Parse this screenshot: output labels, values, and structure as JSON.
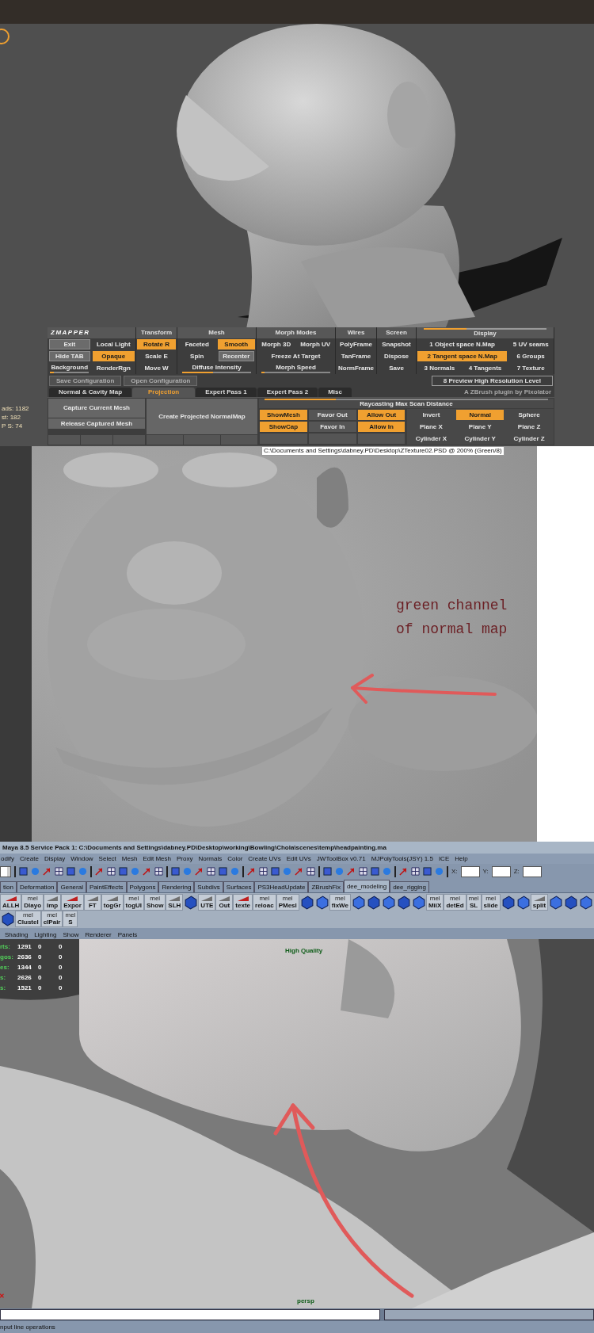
{
  "zbrush": {
    "stats": [
      "ads: 1182",
      "st: 182",
      "P S: 74"
    ],
    "zmapper": {
      "logo": "ZMAPPER",
      "columns": [
        {
          "cells": [
            {
              "kind": "button",
              "label": "Exit"
            },
            {
              "kind": "toggle",
              "label": "Local Light",
              "on": false
            },
            {
              "kind": "button",
              "label": "Hide TAB"
            },
            {
              "kind": "toggle",
              "label": "Opaque",
              "on": true
            },
            {
              "kind": "slider",
              "label": "Background",
              "level": 0.1
            },
            {
              "kind": "toggle",
              "label": "RenderRgn",
              "on": false
            }
          ]
        },
        {
          "title": "Transform",
          "cells": [
            {
              "kind": "toggle",
              "label": "Rotate  R",
              "on": true
            },
            {
              "kind": "toggle",
              "label": "Scale  E",
              "on": false
            },
            {
              "kind": "toggle",
              "label": "Move  W",
              "on": false
            }
          ]
        },
        {
          "title": "Mesh",
          "cells": [
            {
              "kind": "toggle",
              "label": "Faceted",
              "on": false
            },
            {
              "kind": "toggle",
              "label": "Smooth",
              "on": true
            },
            {
              "kind": "toggle",
              "label": "Spin",
              "on": false
            },
            {
              "kind": "button",
              "label": "Recenter"
            },
            {
              "kind": "slider",
              "label": "Diffuse Intensity",
              "level": 0.45
            }
          ]
        },
        {
          "title": "Morph Modes",
          "cells": [
            {
              "kind": "toggle",
              "label": "Morph 3D",
              "on": false
            },
            {
              "kind": "toggle",
              "label": "Morph UV",
              "on": false
            },
            {
              "kind": "toggle",
              "label": "Freeze At Target",
              "on": false
            },
            {
              "kind": "slider",
              "label": "Morph Speed",
              "level": 0.05
            }
          ]
        },
        {
          "title": "Wires",
          "cells": [
            {
              "kind": "toggle",
              "label": "PolyFrame",
              "on": false
            },
            {
              "kind": "toggle",
              "label": "TanFrame",
              "on": false
            },
            {
              "kind": "toggle",
              "label": "NormFrame",
              "on": false
            }
          ]
        },
        {
          "title": "Screen",
          "cells": [
            {
              "kind": "toggle",
              "label": "Snapshot",
              "on": false
            },
            {
              "kind": "toggle",
              "label": "Dispose",
              "on": false
            },
            {
              "kind": "toggle",
              "label": "Save",
              "on": false
            }
          ]
        },
        {
          "title": "Display",
          "level": 0.35,
          "cells": [
            {
              "kind": "toggle",
              "label": "1 Object space N.Map",
              "on": false
            },
            {
              "kind": "toggle",
              "label": "5 UV seams",
              "on": false
            },
            {
              "kind": "toggle",
              "label": "2 Tangent space N.Map",
              "on": true
            },
            {
              "kind": "toggle",
              "label": "6 Groups",
              "on": false
            },
            {
              "kind": "toggle",
              "label": "3 Normals",
              "on": false
            },
            {
              "kind": "toggle",
              "label": "4 Tangents",
              "on": false
            },
            {
              "kind": "toggle",
              "label": "7 Texture",
              "on": false
            }
          ]
        }
      ],
      "config": [
        "Save Configuration",
        "Open Configuration"
      ],
      "preview": "8 Preview High Resolution Level",
      "tabs": [
        {
          "label": "Normal & Cavity Map",
          "selected": false
        },
        {
          "label": "Projection",
          "selected": true
        },
        {
          "label": "Expert Pass 1",
          "selected": false
        },
        {
          "label": "Expert Pass 2",
          "selected": false
        },
        {
          "label": "Misc",
          "selected": false
        }
      ],
      "credit": "A ZBrush plugin by Pixolator",
      "mesh_buttons": [
        "Capture Current Mesh",
        "Release Captured Mesh"
      ],
      "create": "Create Projected NormalMap",
      "scan": {
        "label": "Raycasting Max Scan Distance",
        "level": 0.25
      },
      "options": [
        {
          "label": "ShowMesh",
          "on": true
        },
        {
          "label": "Favor Out",
          "on": false
        },
        {
          "label": "Allow Out",
          "on": true
        },
        {
          "label": "ShowCap",
          "on": true
        },
        {
          "label": "Favor In",
          "on": false
        },
        {
          "label": "Allow In",
          "on": true
        }
      ],
      "shapes": [
        {
          "label": "Invert",
          "on": false
        },
        {
          "label": "Normal",
          "on": true
        },
        {
          "label": "Sphere",
          "on": false
        },
        {
          "label": "Plane X",
          "on": false
        },
        {
          "label": "Plane Y",
          "on": false
        },
        {
          "label": "Plane Z",
          "on": false
        },
        {
          "label": "Cylinder X",
          "on": false
        },
        {
          "label": "Cylinder Y",
          "on": false
        },
        {
          "label": "Cylinder Z",
          "on": false
        }
      ]
    }
  },
  "image_view": {
    "path": "C:\\Documents and Settings\\dabney.PD\\Desktop\\ZTexture02.PSD @ 200% (Green/8)",
    "note": [
      "green channel",
      "of normal map"
    ]
  },
  "maya": {
    "title": "Maya 8.5 Service Pack 1: C:\\Documents and Settings\\dabney.PD\\Desktop\\working\\Bowling\\Chola\\scenes\\temp\\headpainting.ma",
    "menu": [
      "odify",
      "Create",
      "Display",
      "Window",
      "Select",
      "Mesh",
      "Edit Mesh",
      "Proxy",
      "Normals",
      "Color",
      "Create UVs",
      "Edit UVs",
      "JWToolBox v0.71",
      "MJPolyTools(JSY) 1.5",
      "ICE",
      "Help"
    ],
    "coords": [
      "X:",
      "Y:",
      "Z:"
    ],
    "shelf_tabs": [
      {
        "label": "tion",
        "selected": false
      },
      {
        "label": "Deformation",
        "selected": false
      },
      {
        "label": "General",
        "selected": false
      },
      {
        "label": "PaintEffects",
        "selected": false
      },
      {
        "label": "Polygons",
        "selected": false
      },
      {
        "label": "Rendering",
        "selected": false
      },
      {
        "label": "Subdivs",
        "selected": false
      },
      {
        "label": "Surfaces",
        "selected": false
      },
      {
        "label": "PS3HeadUpdate",
        "selected": false
      },
      {
        "label": "ZBrushFix",
        "selected": false
      },
      {
        "label": "dee_modeling",
        "selected": true
      },
      {
        "label": "dee_rigging",
        "selected": false
      }
    ],
    "shelf": [
      {
        "kind": "tool",
        "label": "ALLH"
      },
      {
        "kind": "mel",
        "tag": "mel",
        "label": "Dlayo"
      },
      {
        "kind": "tool",
        "label": "Imp"
      },
      {
        "kind": "tool",
        "label": "Expor"
      },
      {
        "kind": "tool",
        "label": "FT"
      },
      {
        "kind": "tool",
        "label": "togGr"
      },
      {
        "kind": "mel",
        "tag": "mel",
        "label": "togUI"
      },
      {
        "kind": "mel",
        "tag": "mel",
        "label": "Show"
      },
      {
        "kind": "tool",
        "label": "SLH"
      },
      {
        "kind": "icon"
      },
      {
        "kind": "tool",
        "label": "UTE"
      },
      {
        "kind": "tool",
        "label": "Out"
      },
      {
        "kind": "tool",
        "label": "texte"
      },
      {
        "kind": "mel",
        "tag": "mel",
        "label": "reloac"
      },
      {
        "kind": "mel",
        "tag": "mel",
        "label": "PMesl"
      },
      {
        "kind": "icon"
      },
      {
        "kind": "icon"
      },
      {
        "kind": "mel",
        "tag": "mel",
        "label": "fixWe"
      },
      {
        "kind": "icon"
      },
      {
        "kind": "icon"
      },
      {
        "kind": "icon"
      },
      {
        "kind": "icon"
      },
      {
        "kind": "icon"
      },
      {
        "kind": "mel",
        "tag": "mel",
        "label": "MiiX"
      },
      {
        "kind": "mel",
        "tag": "mel",
        "label": "detEd"
      },
      {
        "kind": "mel",
        "tag": "mel",
        "label": "SL"
      },
      {
        "kind": "mel",
        "tag": "mel",
        "label": "slide"
      },
      {
        "kind": "icon"
      },
      {
        "kind": "icon"
      },
      {
        "kind": "tool",
        "label": "split"
      },
      {
        "kind": "icon"
      },
      {
        "kind": "icon"
      },
      {
        "kind": "icon"
      },
      {
        "kind": "icon"
      },
      {
        "kind": "mel",
        "tag": "mel",
        "label": "Clustel"
      },
      {
        "kind": "mel",
        "tag": "mel",
        "label": "clPair"
      },
      {
        "kind": "mel",
        "tag": "mel",
        "label": "S"
      }
    ],
    "panel_menu": [
      "Shading",
      "Lighting",
      "Show",
      "Renderer",
      "Panels"
    ],
    "hud": [
      {
        "label": "rts:",
        "values": [
          "1291",
          "0",
          "0"
        ]
      },
      {
        "label": "gos:",
        "values": [
          "2636",
          "0",
          "0"
        ]
      },
      {
        "label": "es:",
        "values": [
          "1344",
          "0",
          "0"
        ]
      },
      {
        "label": "s:",
        "values": [
          "2626",
          "0",
          "0"
        ]
      },
      {
        "label": "s:",
        "values": [
          "1521",
          "0",
          "0"
        ]
      }
    ],
    "quality": "High Quality",
    "camera": "persp",
    "help_line": "nput line operations"
  }
}
